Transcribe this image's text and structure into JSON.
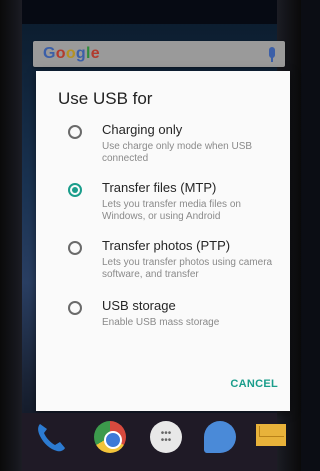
{
  "search_bar": {
    "logo": "Google",
    "mic_icon": "mic-icon"
  },
  "dialog": {
    "title": "Use USB for",
    "options": [
      {
        "label": "Charging only",
        "description": "Use charge only mode when USB connected",
        "selected": false
      },
      {
        "label": "Transfer files (MTP)",
        "description": "Lets you transfer media files on Windows, or using Android",
        "selected": true
      },
      {
        "label": "Transfer photos (PTP)",
        "description": "Lets you transfer photos using camera software, and transfer",
        "selected": false
      },
      {
        "label": "USB storage",
        "description": "Enable USB mass storage",
        "selected": false
      }
    ],
    "cancel_label": "CANCEL"
  },
  "dock": {
    "icons": [
      "phone-icon",
      "chrome-icon",
      "app-drawer-icon",
      "messaging-icon",
      "email-icon"
    ]
  },
  "colors": {
    "accent": "#1a9d8b"
  }
}
